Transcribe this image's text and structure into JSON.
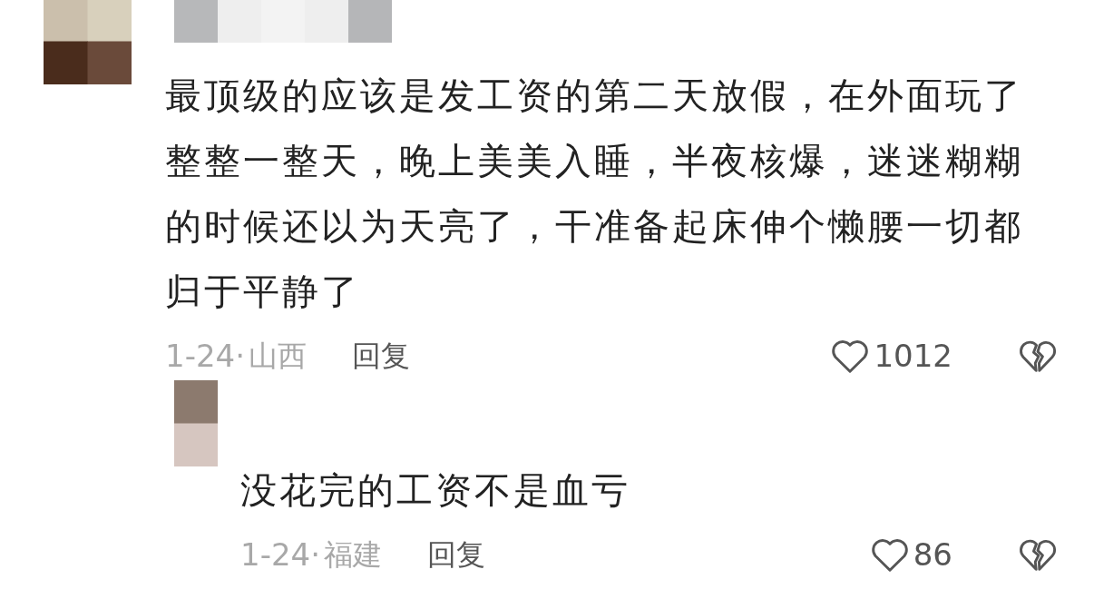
{
  "comments": [
    {
      "text": "最顶级的应该是发工资的第二天放假，在外面玩了整整一整天，晚上美美入睡，半夜核爆，迷迷糊糊的时候还以为天亮了，干准备起床伸个懒腰一切都归于平静了",
      "date": "1-24·",
      "location": "山西",
      "reply": "回复",
      "likes": "1012",
      "replies": [
        {
          "text": "没花完的工资不是血亏",
          "date": "1-24·",
          "location": "福建",
          "reply": "回复",
          "likes": "86"
        }
      ]
    }
  ]
}
